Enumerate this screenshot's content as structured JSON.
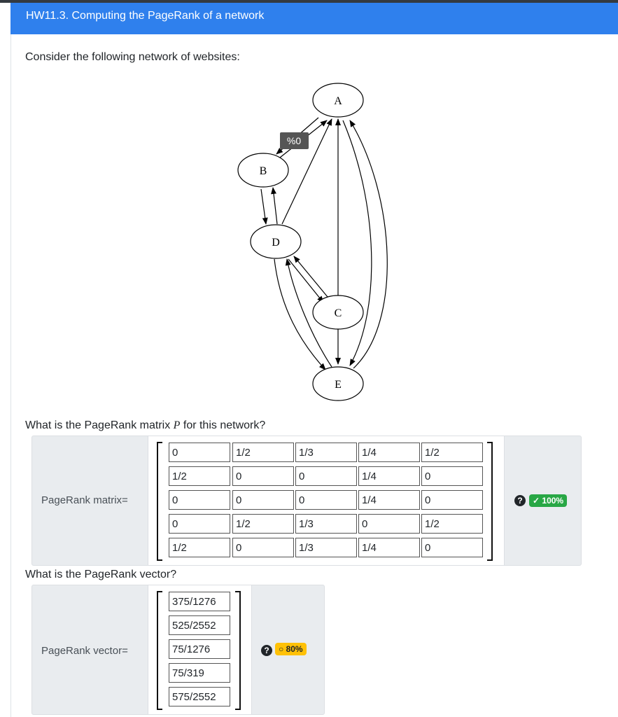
{
  "header": {
    "title": "HW11.3. Computing the PageRank of a network"
  },
  "question": {
    "intro": "Consider the following network of websites:",
    "matrix_prompt_before": "What is the PageRank matrix ",
    "matrix_symbol": "P",
    "matrix_prompt_after": " for this network?",
    "vector_prompt": "What is the PageRank vector?"
  },
  "graph": {
    "nodes": [
      "A",
      "B",
      "C",
      "D",
      "E"
    ],
    "edge_tooltip": "%0"
  },
  "matrix_group": {
    "label": "PageRank matrix=",
    "rows": [
      [
        "0",
        "1/2",
        "1/3",
        "1/4",
        "1/2"
      ],
      [
        "1/2",
        "0",
        "0",
        "1/4",
        "0"
      ],
      [
        "0",
        "0",
        "0",
        "1/4",
        "0"
      ],
      [
        "0",
        "1/2",
        "1/3",
        "0",
        "1/2"
      ],
      [
        "1/2",
        "0",
        "1/3",
        "1/4",
        "0"
      ]
    ],
    "help_icon": "question-circle-icon",
    "score": "✓ 100%",
    "score_color": "#28a745"
  },
  "vector_group": {
    "label": "PageRank vector=",
    "values": [
      "375/1276",
      "525/2552",
      "75/1276",
      "75/319",
      "575/2552"
    ],
    "help_icon": "question-circle-icon",
    "score": "○ 80%",
    "score_color": "#ffc107"
  },
  "colors": {
    "header_bg": "#2f80ed",
    "group_bg": "#e9ecef"
  }
}
